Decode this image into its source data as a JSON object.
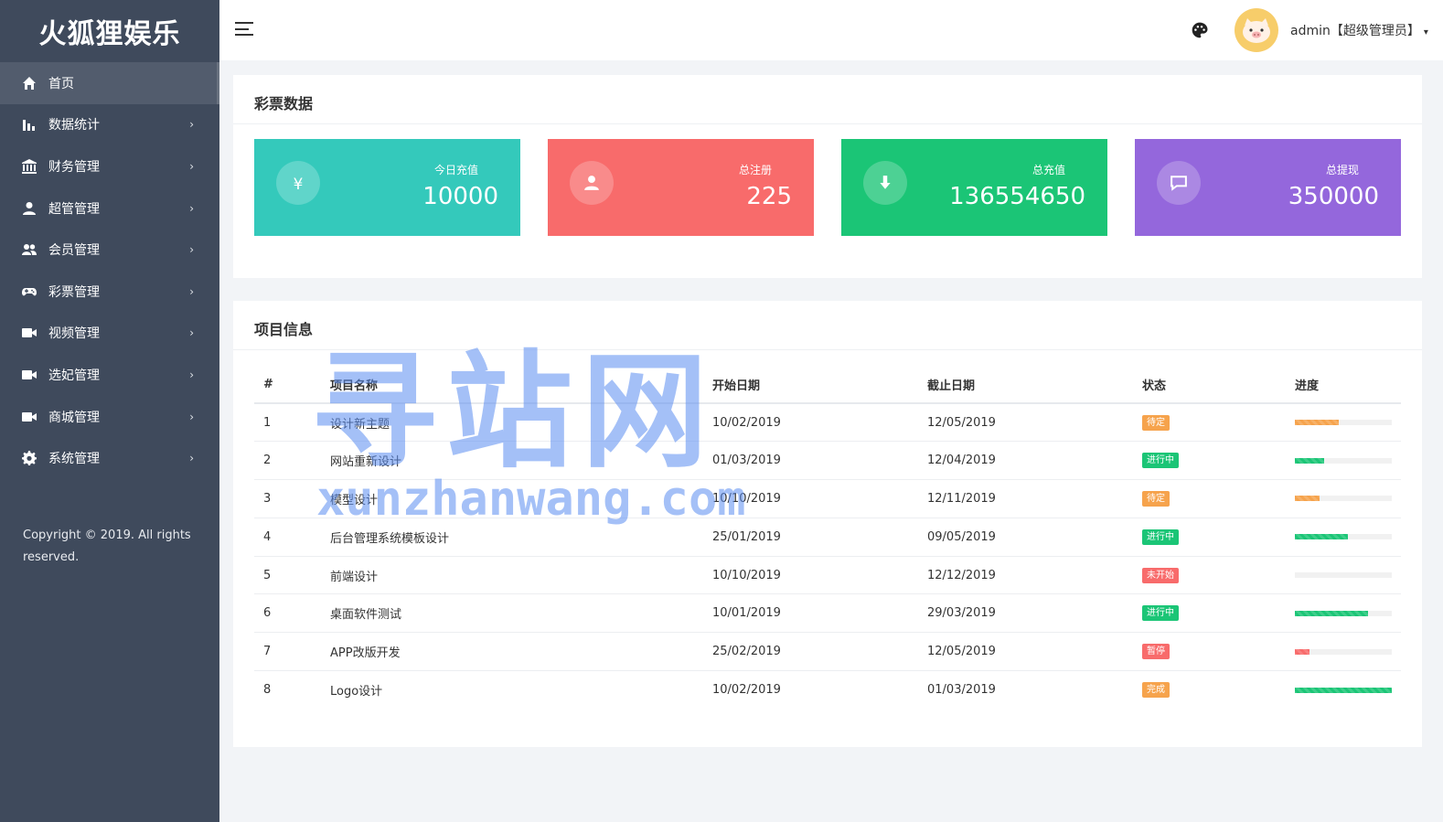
{
  "brand": "火狐狸娱乐",
  "sidebar": {
    "items": [
      {
        "label": "首页",
        "icon": "home-icon",
        "active": true
      },
      {
        "label": "数据统计",
        "icon": "bar-chart-icon"
      },
      {
        "label": "财务管理",
        "icon": "bank-icon"
      },
      {
        "label": "超管管理",
        "icon": "user-icon"
      },
      {
        "label": "会员管理",
        "icon": "users-icon"
      },
      {
        "label": "彩票管理",
        "icon": "gamepad-icon"
      },
      {
        "label": "视频管理",
        "icon": "video-icon"
      },
      {
        "label": "选妃管理",
        "icon": "video-icon"
      },
      {
        "label": "商城管理",
        "icon": "video-icon"
      },
      {
        "label": "系统管理",
        "icon": "gear-icon"
      }
    ],
    "arrow": "›",
    "copyright": "Copyright © 2019. All rights reserved."
  },
  "header": {
    "user": "admin【超级管理员】",
    "user_caret": "▾"
  },
  "lottery": {
    "title": "彩票数据",
    "cards": [
      {
        "label": "今日充值",
        "value": "10000",
        "color": "#34c9bb",
        "icon": "yen-icon"
      },
      {
        "label": "总注册",
        "value": "225",
        "color": "#f86b6b",
        "icon": "user-icon"
      },
      {
        "label": "总充值",
        "value": "136554650",
        "color": "#1bc576",
        "icon": "download-icon"
      },
      {
        "label": "总提现",
        "value": "350000",
        "color": "#9467dc",
        "icon": "message-icon"
      }
    ]
  },
  "projects": {
    "title": "项目信息",
    "columns": [
      "#",
      "项目名称",
      "开始日期",
      "截止日期",
      "状态",
      "进度"
    ],
    "rows": [
      {
        "no": "1",
        "name": "设计新主题",
        "start": "10/02/2019",
        "end": "12/05/2019",
        "status": "待定",
        "status_color": "#f6a34c",
        "progress": 0.45,
        "bar_color": "#f6a34c"
      },
      {
        "no": "2",
        "name": "网站重新设计",
        "start": "01/03/2019",
        "end": "12/04/2019",
        "status": "进行中",
        "status_color": "#1bc576",
        "progress": 0.3,
        "bar_color": "#1bc576"
      },
      {
        "no": "3",
        "name": "模型设计",
        "start": "10/10/2019",
        "end": "12/11/2019",
        "status": "待定",
        "status_color": "#f6a34c",
        "progress": 0.25,
        "bar_color": "#f6a34c"
      },
      {
        "no": "4",
        "name": "后台管理系统模板设计",
        "start": "25/01/2019",
        "end": "09/05/2019",
        "status": "进行中",
        "status_color": "#1bc576",
        "progress": 0.55,
        "bar_color": "#1bc576"
      },
      {
        "no": "5",
        "name": "前端设计",
        "start": "10/10/2019",
        "end": "12/12/2019",
        "status": "未开始",
        "status_color": "#f86b6b",
        "progress": 0.0,
        "bar_color": "#f86b6b"
      },
      {
        "no": "6",
        "name": "桌面软件测试",
        "start": "10/01/2019",
        "end": "29/03/2019",
        "status": "进行中",
        "status_color": "#1bc576",
        "progress": 0.75,
        "bar_color": "#1bc576"
      },
      {
        "no": "7",
        "name": "APP改版开发",
        "start": "25/02/2019",
        "end": "12/05/2019",
        "status": "暂停",
        "status_color": "#f86b6b",
        "progress": 0.15,
        "bar_color": "#f86b6b"
      },
      {
        "no": "8",
        "name": "Logo设计",
        "start": "10/02/2019",
        "end": "01/03/2019",
        "status": "完成",
        "status_color": "#f6a34c",
        "progress": 1.0,
        "bar_color": "#1bc576"
      }
    ]
  },
  "watermark": {
    "big": "寻站网",
    "small": "xunzhanwang.com"
  }
}
